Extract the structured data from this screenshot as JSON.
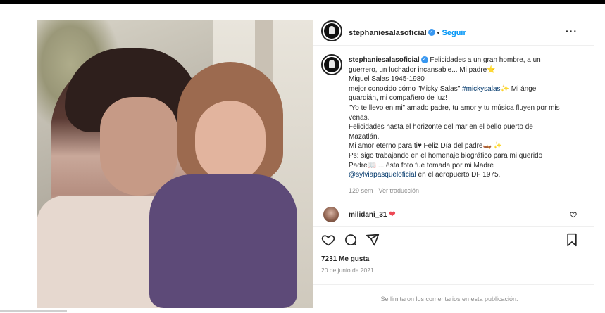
{
  "post": {
    "username": "stephaniesalasoficial",
    "follow_label": "Seguir",
    "separator": "•",
    "more_label": "···"
  },
  "caption": {
    "username": "stephaniesalasoficial",
    "line1": "Felicidades a un gran hombre, a un guerrero, un luchador incansable... Mi padre⭐",
    "line2": "Miguel Salas 1945-1980",
    "line3a": "mejor conocido cómo \"Micky Salas\" ",
    "line3_tag": "#mickysalas",
    "line3b": "✨ Mi ángel guardián, mi compañero de luz!",
    "line4": "\"Yo te llevo en mi\" amado padre, tu amor y tu música fluyen por mis venas.",
    "line5": "Felicidades hasta el horizonte del mar en el bello puerto de Mazatlán.",
    "line6": "Mi amor eterno para ti♥ Feliz Día del padre🛶 ✨",
    "line7": "Ps: sigo trabajando en el homenaje biográfico para mi querido Padre📖 ... ésta foto fue tomada por mi Madre",
    "line8_tag": "@sylviapasqueloficial",
    "line8b": " en el aeropuerto DF 1975."
  },
  "meta": {
    "age": "129 sem",
    "translate": "Ver traducción"
  },
  "comment": {
    "username": "milidani_31",
    "heart": "❤"
  },
  "stats": {
    "likes": "7231 Me gusta",
    "date": "20 de junio de 2021"
  },
  "footer": {
    "limited": "Se limitaron los comentarios en esta publicación."
  },
  "icons": {
    "heart": "heart-icon",
    "comment": "comment-icon",
    "share": "share-icon",
    "save": "bookmark-icon"
  },
  "colors": {
    "link": "#0095f6",
    "tag": "#00376b",
    "muted": "#8e8e8e",
    "heart": "#ed4956"
  }
}
